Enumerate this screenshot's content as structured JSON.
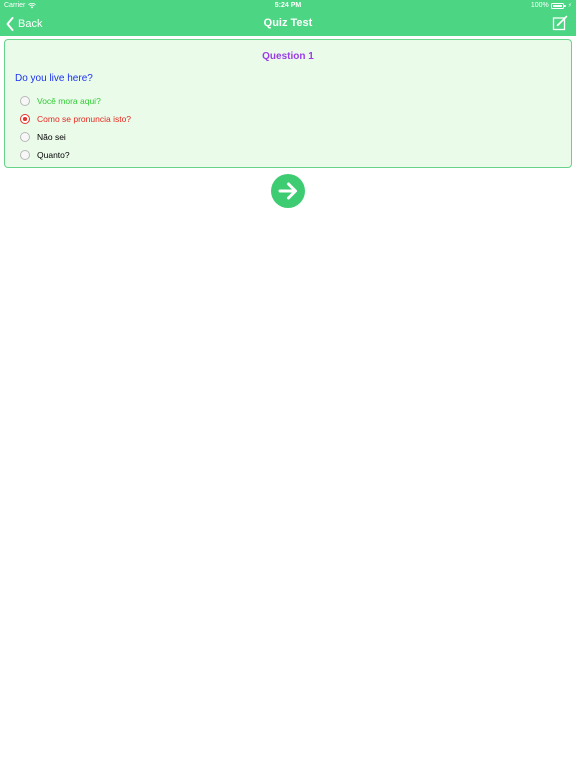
{
  "status_bar": {
    "carrier": "Carrier",
    "time": "5:24 PM",
    "battery": "100%"
  },
  "nav": {
    "back_label": "Back",
    "title": "Quiz Test"
  },
  "question": {
    "number_label": "Question 1",
    "text": "Do you live here?",
    "options": [
      {
        "label": "Você mora aqui?",
        "state": "correct"
      },
      {
        "label": "Como se pronuncia isto?",
        "state": "selected-wrong"
      },
      {
        "label": "Não sei",
        "state": "none"
      },
      {
        "label": "Quanto?",
        "state": "none"
      }
    ]
  },
  "colors": {
    "header": "#4cd583",
    "card_background": "#eafbea",
    "question_number": "#9b3ce6",
    "question_text": "#1b32f0",
    "correct": "#2fcc32",
    "wrong": "#e8271e",
    "next_button": "#3ecc73"
  },
  "icons": {
    "back": "chevron-left-icon",
    "edit": "edit-icon",
    "next": "arrow-right-icon"
  }
}
